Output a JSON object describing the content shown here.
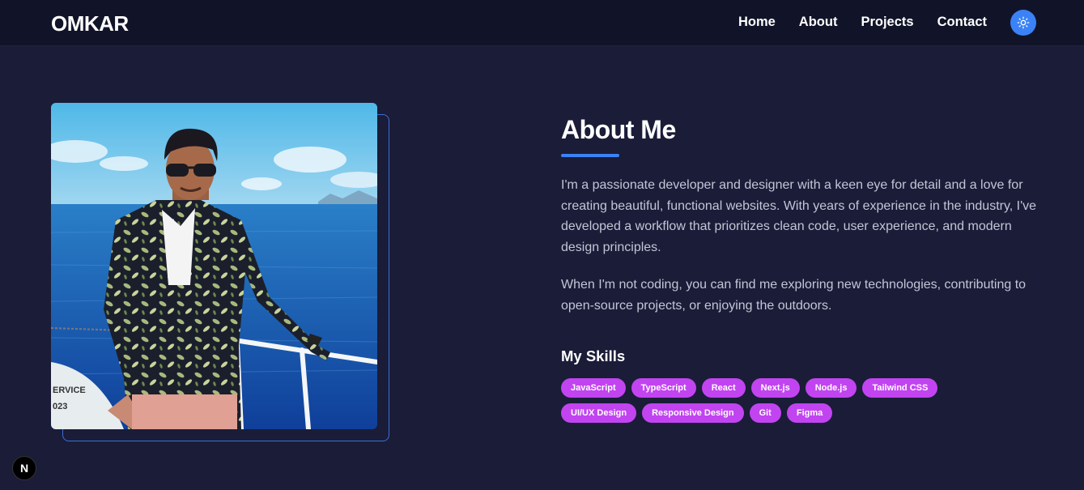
{
  "header": {
    "logo": "OMKAR",
    "nav": [
      {
        "label": "Home"
      },
      {
        "label": "About"
      },
      {
        "label": "Projects"
      },
      {
        "label": "Contact"
      }
    ],
    "theme_toggle_icon": "sun-icon"
  },
  "about": {
    "title": "About Me",
    "paragraphs": [
      "I'm a passionate developer and designer with a keen eye for detail and a love for creating beautiful, functional websites. With years of experience in the industry, I've developed a workflow that prioritizes clean code, user experience, and modern design principles.",
      "When I'm not coding, you can find me exploring new technologies, contributing to open-source projects, or enjoying the outdoors."
    ],
    "skills_title": "My Skills",
    "skills": [
      "JavaScript",
      "TypeScript",
      "React",
      "Next.js",
      "Node.js",
      "Tailwind CSS",
      "UI/UX Design",
      "Responsive Design",
      "Git",
      "Figma"
    ]
  },
  "photo": {
    "boat_text_line1": "ERVICE",
    "boat_text_line2": "023"
  },
  "dev_badge": {
    "label": "N"
  },
  "colors": {
    "background": "#1a1c38",
    "navbar": "#111428",
    "accent": "#3b82f6",
    "chip": "#c144f0",
    "body_text": "#c2c6d6"
  }
}
